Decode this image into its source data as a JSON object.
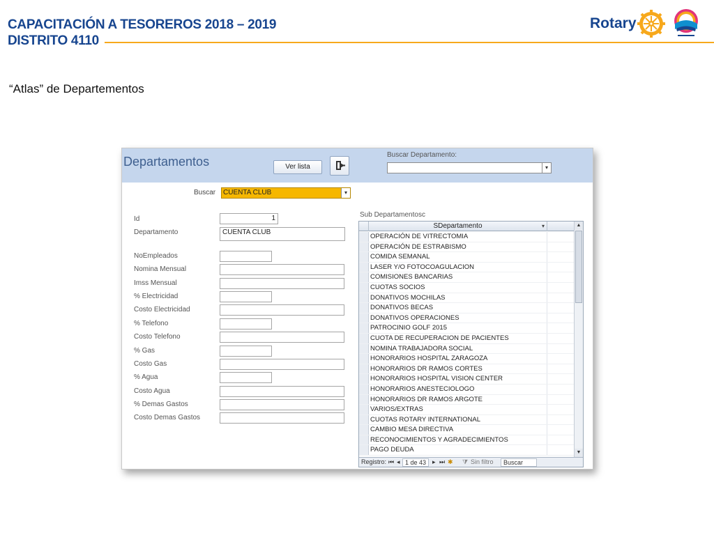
{
  "slide": {
    "title_line1": "CAPACITACIÓN A TESOREROS 2018 – 2019",
    "title_line2": "DISTRITO 4110",
    "rotary_word": "Rotary",
    "subtitle": "“Atlas” de Departementos",
    "colors": {
      "title": "#17458f",
      "rule": "#f7a81b"
    }
  },
  "form": {
    "title": "Departamentos",
    "ver_lista_label": "Ver lista",
    "buscar_departamento_label": "Buscar Departamento:",
    "buscar_departamento_value": "",
    "buscar_label": "Buscar",
    "buscar_value": "CUENTA CLUB",
    "fields": [
      {
        "label": "Id",
        "value": "1"
      },
      {
        "label": "Departamento",
        "value": "CUENTA CLUB"
      },
      {
        "label": "NoEmpleados",
        "value": ""
      },
      {
        "label": "Nomina Mensual",
        "value": ""
      },
      {
        "label": "Imss Mensual",
        "value": ""
      },
      {
        "label": "% Electricidad",
        "value": ""
      },
      {
        "label": "Costo Electricidad",
        "value": ""
      },
      {
        "label": "% Telefono",
        "value": ""
      },
      {
        "label": "Costo Telefono",
        "value": ""
      },
      {
        "label": "% Gas",
        "value": ""
      },
      {
        "label": "Costo Gas",
        "value": ""
      },
      {
        "label": "% Agua",
        "value": ""
      },
      {
        "label": "Costo Agua",
        "value": ""
      },
      {
        "label": "% Demas Gastos",
        "value": ""
      },
      {
        "label": "Costo Demas Gastos",
        "value": ""
      }
    ]
  },
  "subform": {
    "label": "Sub Departamentosc",
    "column": "SDepartamento",
    "rows": [
      "OPERACIÓN DE VITRECTOMIA",
      "OPERACIÓN DE ESTRABISMO",
      "COMIDA SEMANAL",
      "LASER Y/O FOTOCOAGULACION",
      "COMISIONES BANCARIAS",
      "CUOTAS SOCIOS",
      "DONATIVOS MOCHILAS",
      "DONATIVOS BECAS",
      "DONATIVOS OPERACIONES",
      "PATROCINIO GOLF 2015",
      "CUOTA DE RECUPERACION DE PACIENTES",
      "NOMINA TRABAJADORA SOCIAL",
      "HONORARIOS HOSPITAL ZARAGOZA",
      "HONORARIOS DR RAMOS CORTES",
      "HONORARIOS HOSPITAL VISION CENTER",
      "HONORARIOS ANESTECIOLOGO",
      "HONORARIOS DR RAMOS ARGOTE",
      "VARIOS/EXTRAS",
      "CUOTAS ROTARY INTERNATIONAL",
      "CAMBIO MESA DIRECTIVA",
      "RECONOCIMIENTOS Y AGRADECIMIENTOS",
      "PAGO DEUDA"
    ],
    "nav": {
      "registro_label": "Registro:",
      "counter": "1 de 43",
      "sin_filtro": "Sin filtro",
      "search_placeholder": "Buscar"
    }
  }
}
